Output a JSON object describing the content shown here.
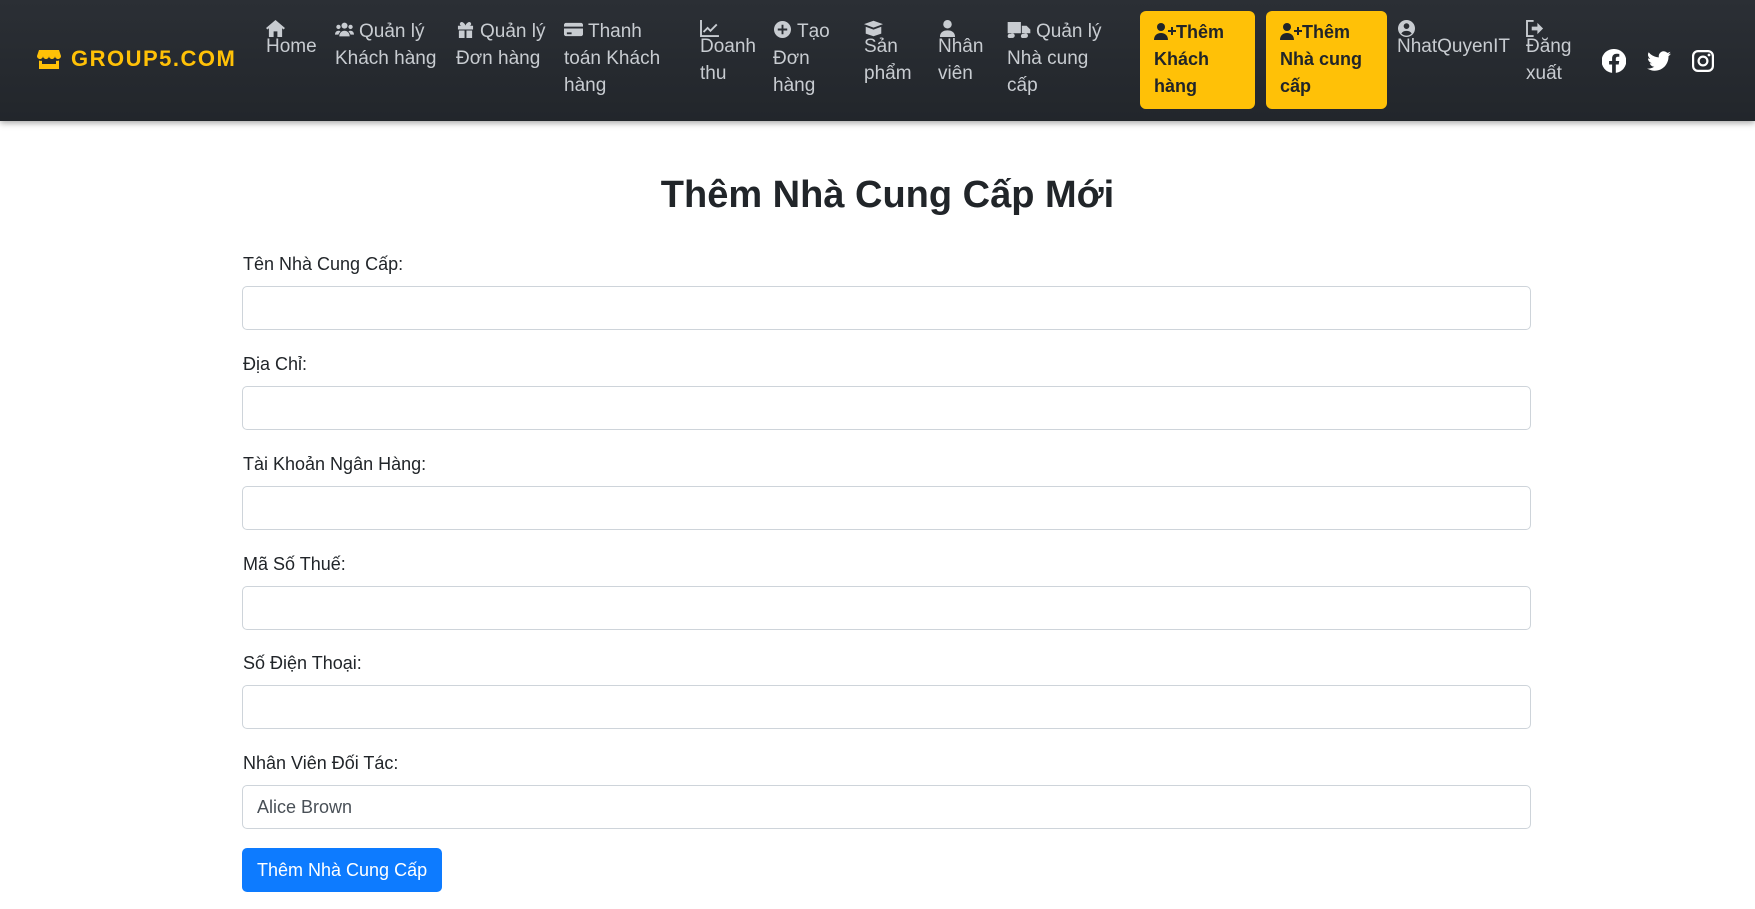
{
  "navbar": {
    "brand": {
      "label": "GROUP5.COM",
      "icon": "store-icon",
      "color": "#ffc107"
    },
    "items": [
      {
        "icon": "home-icon",
        "label": "Home"
      },
      {
        "icon": "users-icon",
        "label": "Quản lý\nKhách hàng"
      },
      {
        "icon": "gift-icon",
        "label": "Quản lý\nĐơn hàng"
      },
      {
        "icon": "credit-card-icon",
        "label": "Thanh\ntoán Khách\nhàng"
      },
      {
        "icon": "chart-line-icon",
        "label": "Doanh\nthu"
      },
      {
        "icon": "plus-circle-icon",
        "label": "Tạo\nĐơn\nhàng"
      },
      {
        "icon": "box-open-icon",
        "label": "Sản\nphẩm"
      },
      {
        "icon": "user-tie-icon",
        "label": "Nhân\nviên"
      },
      {
        "icon": "truck-icon",
        "label": "Quản lý\nNhà cung\ncấp"
      }
    ],
    "buttons": [
      {
        "icon": "user-plus-icon",
        "label": "Thêm\nKhách\nhàng"
      },
      {
        "icon": "user-plus-icon",
        "label": "Thêm\nNhà cung\ncấp"
      }
    ],
    "user": {
      "icon": "user-circle-icon",
      "label": "NhatQuyenIT"
    },
    "logout": {
      "icon": "sign-out-icon",
      "label": "Đăng\nxuất"
    },
    "social": [
      "facebook-icon",
      "twitter-icon",
      "instagram-icon"
    ]
  },
  "form": {
    "title": "Thêm Nhà Cung Cấp Mới",
    "fields": [
      {
        "label": "Tên Nhà Cung Cấp:",
        "value": ""
      },
      {
        "label": "Địa Chỉ:",
        "value": ""
      },
      {
        "label": "Tài Khoản Ngân Hàng:",
        "value": ""
      },
      {
        "label": "Mã Số Thuế:",
        "value": ""
      },
      {
        "label": "Số Điện Thoại:",
        "value": ""
      }
    ],
    "partner": {
      "label": "Nhân Viên Đối Tác:",
      "selected": "Alice Brown"
    },
    "submit_label": "Thêm Nhà Cung Cấp",
    "accent_color": "#0d7bff"
  }
}
